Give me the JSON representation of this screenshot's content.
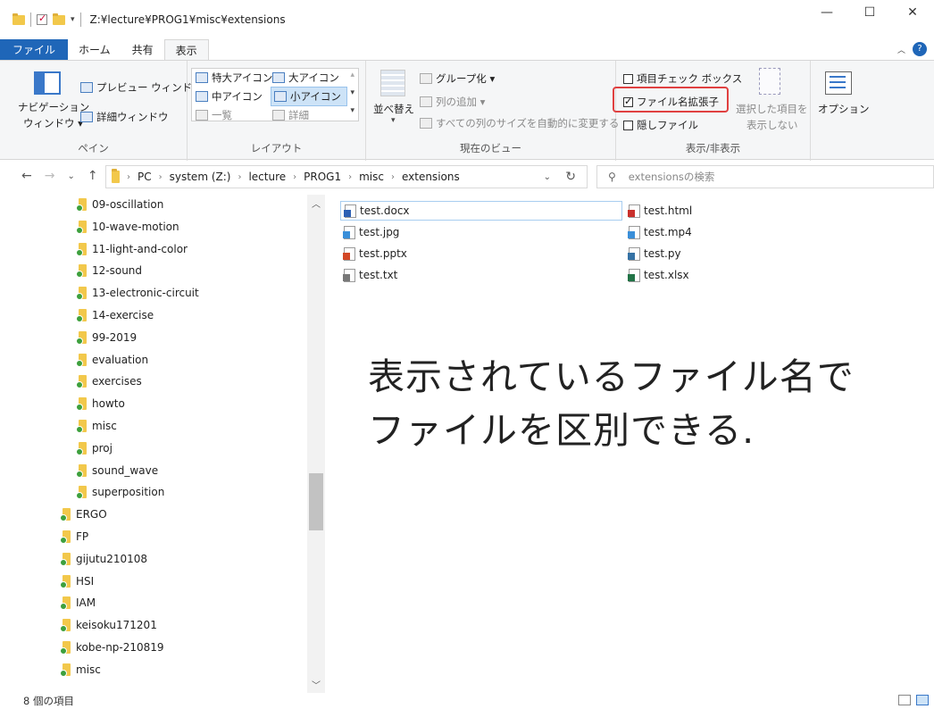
{
  "window": {
    "title": "Z:¥lecture¥PROG1¥misc¥extensions",
    "minimize": "—",
    "maximize": "☐",
    "close": "✕"
  },
  "tabs": {
    "file": "ファイル",
    "home": "ホーム",
    "share": "共有",
    "view": "表示"
  },
  "ribbon": {
    "pane": {
      "nav_pane_line1": "ナビゲーション",
      "nav_pane_line2": "ウィンドウ ▾",
      "preview": "プレビュー ウィンドウ",
      "details": "詳細ウィンドウ",
      "label": "ペイン"
    },
    "layout": {
      "extra_large": "特大アイコン",
      "large": "大アイコン",
      "medium": "中アイコン",
      "small": "小アイコン",
      "list": "一覧",
      "details": "詳細",
      "label": "レイアウト"
    },
    "current_view": {
      "sort": "並べ替え",
      "group": "グループ化 ▾",
      "add_columns": "列の追加 ▾",
      "size_columns": "すべての列のサイズを自動的に変更する",
      "label": "現在のビュー"
    },
    "show_hide": {
      "item_check": "項目チェック ボックス",
      "extensions": "ファイル名拡張子",
      "hidden": "隠しファイル",
      "hide_selected_line1": "選択した項目を",
      "hide_selected_line2": "表示しない",
      "label": "表示/非表示",
      "item_check_checked": false,
      "extensions_checked": true,
      "hidden_checked": false
    },
    "options": "オプション"
  },
  "address": {
    "crumbs": [
      "PC",
      "system (Z:)",
      "lecture",
      "PROG1",
      "misc",
      "extensions"
    ],
    "search_placeholder": "extensionsの検索"
  },
  "tree": [
    {
      "label": "09-oscillation",
      "level": 2
    },
    {
      "label": "10-wave-motion",
      "level": 2
    },
    {
      "label": "11-light-and-color",
      "level": 2
    },
    {
      "label": "12-sound",
      "level": 2
    },
    {
      "label": "13-electronic-circuit",
      "level": 2
    },
    {
      "label": "14-exercise",
      "level": 2
    },
    {
      "label": "99-2019",
      "level": 2
    },
    {
      "label": "evaluation",
      "level": 2
    },
    {
      "label": "exercises",
      "level": 2
    },
    {
      "label": "howto",
      "level": 2
    },
    {
      "label": "misc",
      "level": 2
    },
    {
      "label": "proj",
      "level": 2
    },
    {
      "label": "sound_wave",
      "level": 2
    },
    {
      "label": "superposition",
      "level": 2
    },
    {
      "label": "ERGO",
      "level": 1
    },
    {
      "label": "FP",
      "level": 1
    },
    {
      "label": "gijutu210108",
      "level": 1
    },
    {
      "label": "HSI",
      "level": 1
    },
    {
      "label": "IAM",
      "level": 1
    },
    {
      "label": "keisoku171201",
      "level": 1
    },
    {
      "label": "kobe-np-210819",
      "level": 1
    },
    {
      "label": "misc",
      "level": 1
    }
  ],
  "files_left": [
    {
      "name": "test.docx",
      "color": "#2b5fb4"
    },
    {
      "name": "test.jpg",
      "color": "#3a8fd9"
    },
    {
      "name": "test.pptx",
      "color": "#d24726"
    },
    {
      "name": "test.txt",
      "color": "#777777"
    }
  ],
  "files_right": [
    {
      "name": "test.html",
      "color": "#c9302c"
    },
    {
      "name": "test.mp4",
      "color": "#3a8fd9"
    },
    {
      "name": "test.py",
      "color": "#3572a5"
    },
    {
      "name": "test.xlsx",
      "color": "#217346"
    }
  ],
  "overlay": {
    "line1": "表示されているファイル名で",
    "line2": "ファイルを区別できる."
  },
  "status": {
    "count": "8 個の項目"
  }
}
